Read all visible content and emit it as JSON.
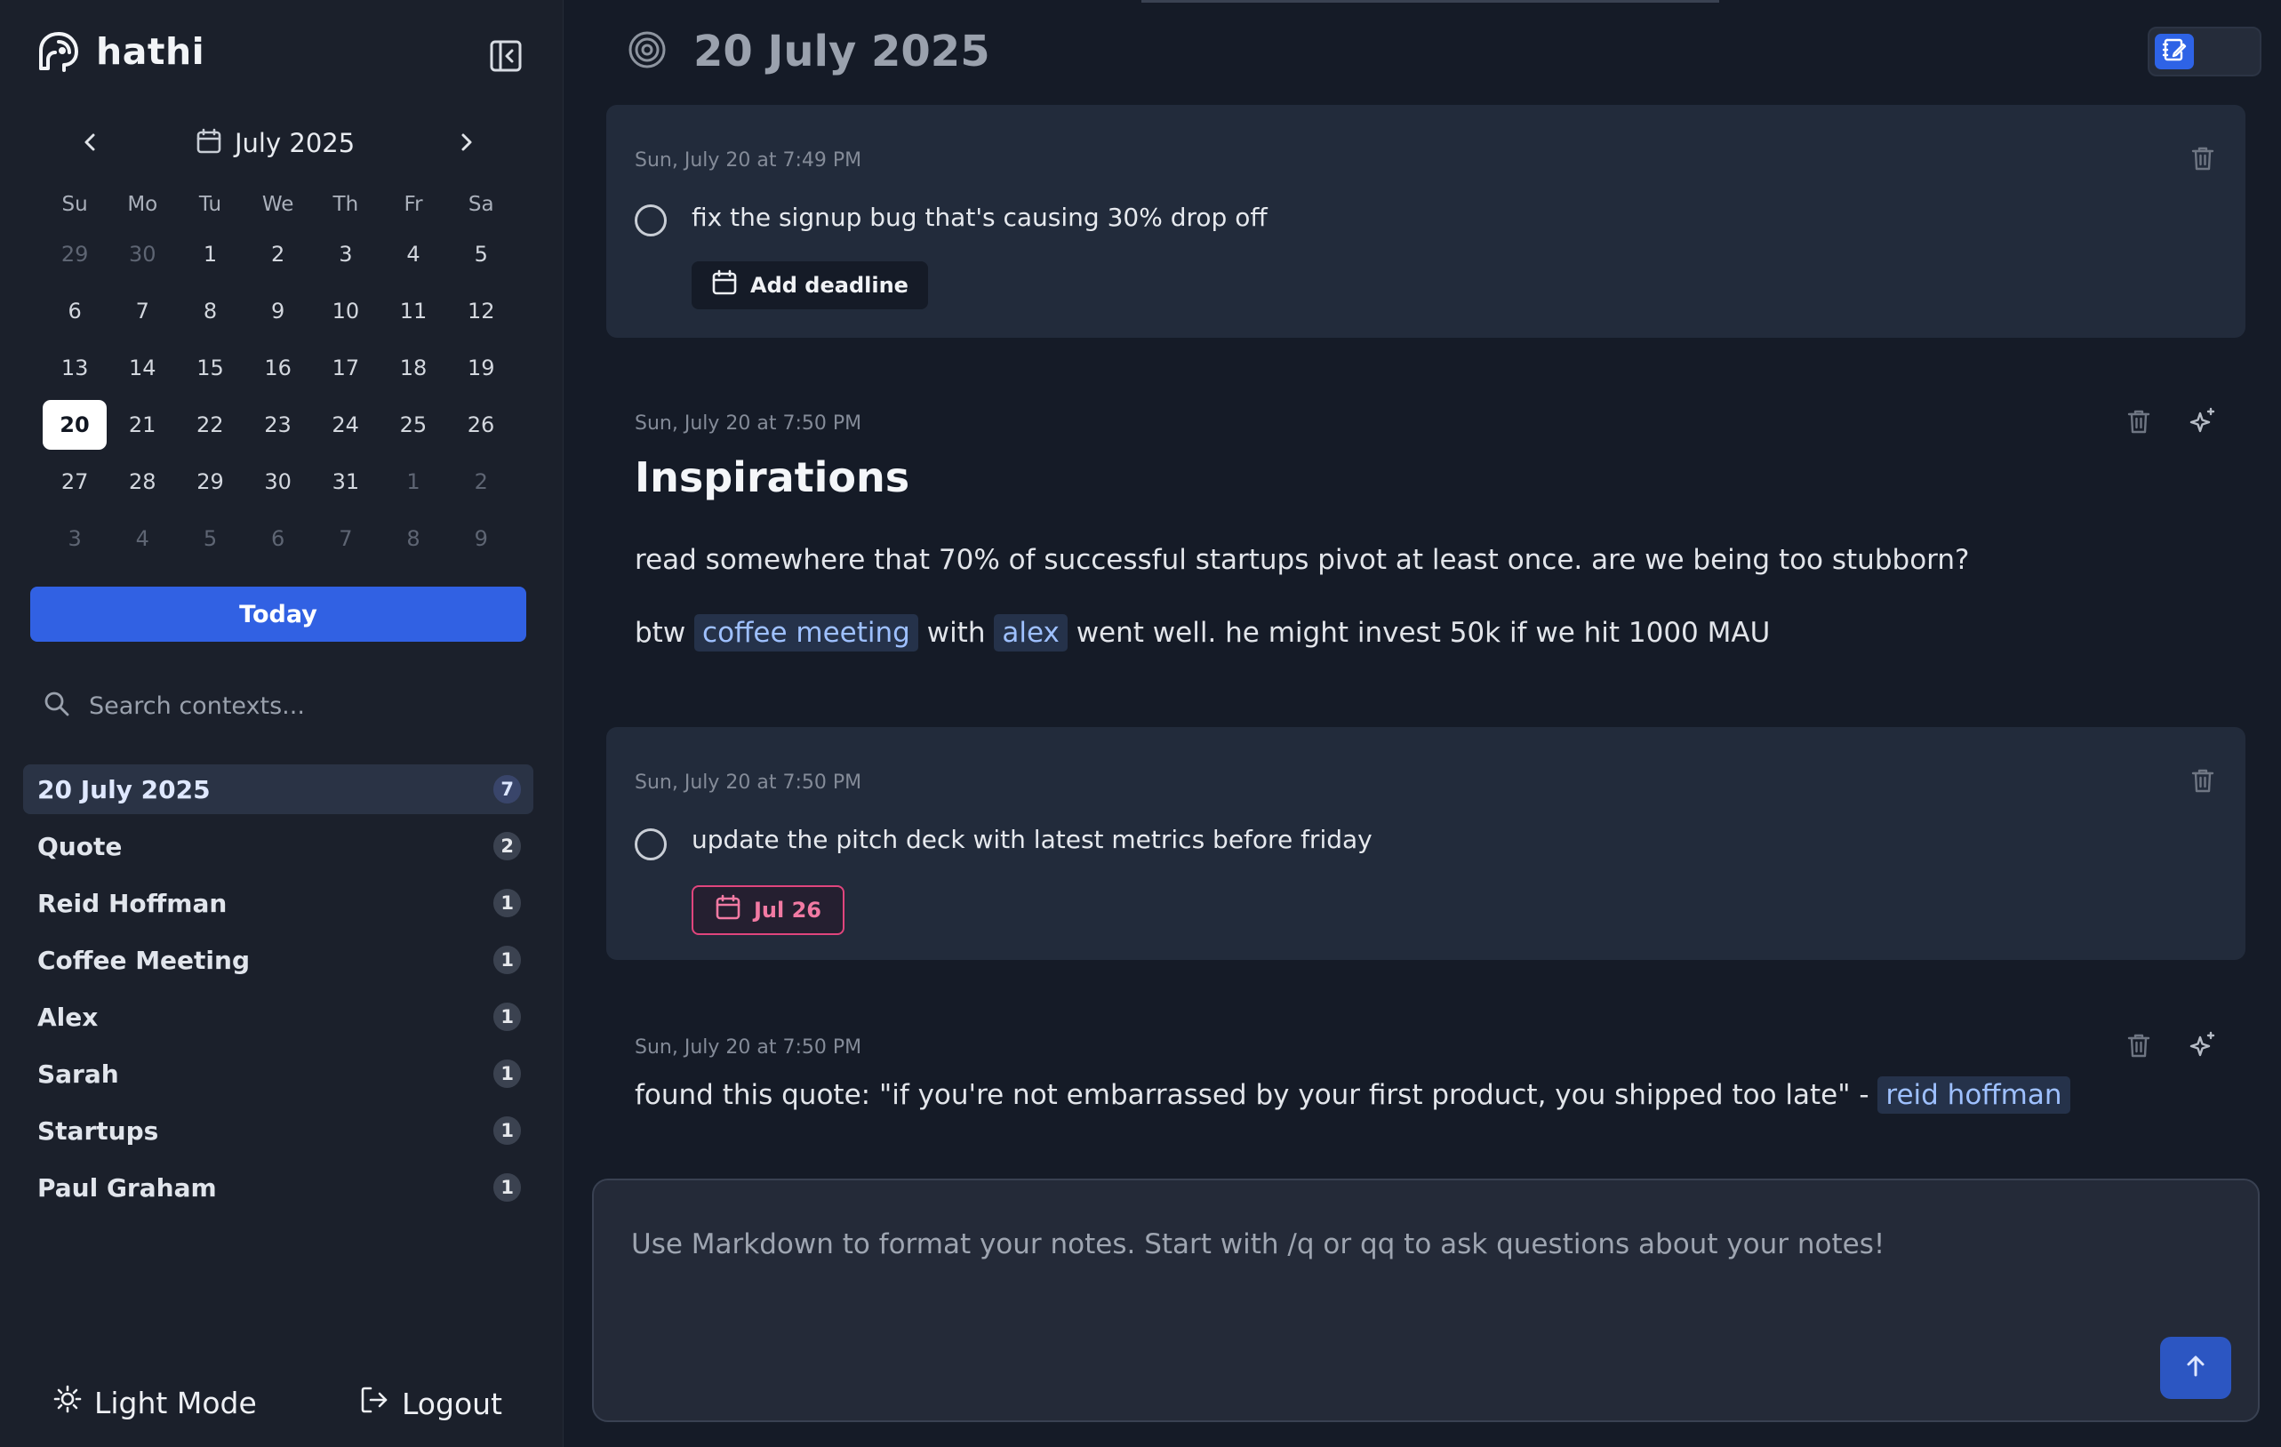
{
  "app": {
    "name": "hathi"
  },
  "calendar": {
    "month_label": "July 2025",
    "weekdays": [
      "Su",
      "Mo",
      "Tu",
      "We",
      "Th",
      "Fr",
      "Sa"
    ],
    "weeks": [
      [
        "29",
        "30",
        "1",
        "2",
        "3",
        "4",
        "5"
      ],
      [
        "6",
        "7",
        "8",
        "9",
        "10",
        "11",
        "12"
      ],
      [
        "13",
        "14",
        "15",
        "16",
        "17",
        "18",
        "19"
      ],
      [
        "20",
        "21",
        "22",
        "23",
        "24",
        "25",
        "26"
      ],
      [
        "27",
        "28",
        "29",
        "30",
        "31",
        "1",
        "2"
      ],
      [
        "3",
        "4",
        "5",
        "6",
        "7",
        "8",
        "9"
      ]
    ],
    "selected_day": "20",
    "today_label": "Today"
  },
  "search": {
    "placeholder": "Search contexts..."
  },
  "contexts": [
    {
      "label": "20 July 2025",
      "count": "7",
      "active": true
    },
    {
      "label": "Quote",
      "count": "2"
    },
    {
      "label": "Reid Hoffman",
      "count": "1"
    },
    {
      "label": "Coffee Meeting",
      "count": "1"
    },
    {
      "label": "Alex",
      "count": "1"
    },
    {
      "label": "Sarah",
      "count": "1"
    },
    {
      "label": "Startups",
      "count": "1"
    },
    {
      "label": "Paul Graham",
      "count": "1"
    }
  ],
  "footer": {
    "light_mode_label": "Light Mode",
    "logout_label": "Logout"
  },
  "page": {
    "title": "20 July 2025"
  },
  "notes": [
    {
      "type": "task",
      "timestamp": "Sun, July 20 at 7:49 PM",
      "text": "fix the signup bug that's causing 30% drop off",
      "deadline_label": "Add deadline"
    },
    {
      "type": "note",
      "timestamp": "Sun, July 20 at 7:50 PM",
      "heading": "Inspirations",
      "para1": "read somewhere that 70% of successful startups pivot at least once. are we being too stubborn?",
      "para2": {
        "t1": "btw",
        "tag1": "coffee meeting",
        "t2": "with",
        "tag2": "alex",
        "t3": "went well. he might invest 50k if we hit 1000 MAU"
      }
    },
    {
      "type": "task",
      "timestamp": "Sun, July 20 at 7:50 PM",
      "text": "update the pitch deck with latest metrics before friday",
      "due_label": "Jul 26"
    },
    {
      "type": "note",
      "timestamp": "Sun, July 20 at 7:50 PM",
      "text": "found this quote: \"if you're not embarrassed by your first product, you shipped too late\" -",
      "tag": "reid hoffman"
    }
  ],
  "composer": {
    "placeholder": "Use Markdown to format your notes. Start with /q or qq to ask questions about your notes!"
  },
  "colors": {
    "accent": "#3161e3",
    "due": "#e0457d",
    "tag_text": "#9ec0ff"
  }
}
